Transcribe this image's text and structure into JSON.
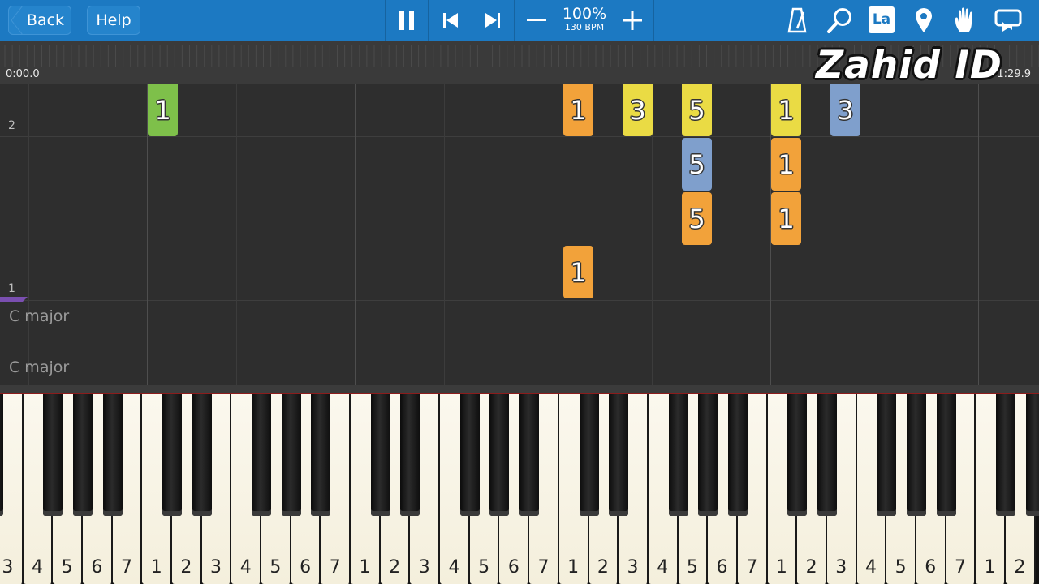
{
  "toolbar": {
    "back_label": "Back",
    "help_label": "Help",
    "zoom_percent": "100%",
    "tempo": "130 BPM",
    "icons": [
      "pause-icon",
      "skip-previous-icon",
      "skip-next-icon",
      "minus-icon",
      "plus-icon",
      "metronome-icon",
      "search-icon",
      "la-label-icon",
      "location-pin-icon",
      "hand-icon",
      "loop-icon"
    ],
    "la_label": "La",
    "color": "#1c79c2"
  },
  "timeline": {
    "start_time": "0:00.0",
    "end_time": "1:29.9",
    "watermark": "Zahid ID"
  },
  "notefield": {
    "staff_labels": [
      "2",
      "1"
    ],
    "key_labels": [
      "C major",
      "C major"
    ],
    "notes": [
      {
        "label": "1",
        "color": "#7ec04a"
      },
      {
        "label": "1",
        "color": "#f2a23a"
      },
      {
        "label": "3",
        "color": "#eadb44"
      },
      {
        "label": "5",
        "color": "#eadb44"
      },
      {
        "label": "1",
        "color": "#eadb44"
      },
      {
        "label": "3",
        "color": "#7f9fcc"
      },
      {
        "label": "5",
        "color": "#7f9fcc"
      },
      {
        "label": "1",
        "color": "#f2a23a"
      },
      {
        "label": "5",
        "color": "#f2a23a"
      },
      {
        "label": "1",
        "color": "#f2a23a"
      },
      {
        "label": "1",
        "color": "#f2a23a"
      }
    ]
  },
  "keyboard": {
    "white_key_labels": [
      "3",
      "4",
      "5",
      "6",
      "7",
      "1",
      "2",
      "3",
      "4",
      "5",
      "6",
      "7",
      "1",
      "2",
      "3",
      "4",
      "5",
      "6",
      "7",
      "1",
      "2",
      "3",
      "4",
      "5",
      "6",
      "7",
      "1",
      "2",
      "3",
      "4",
      "5",
      "6",
      "7",
      "1",
      "2"
    ]
  }
}
